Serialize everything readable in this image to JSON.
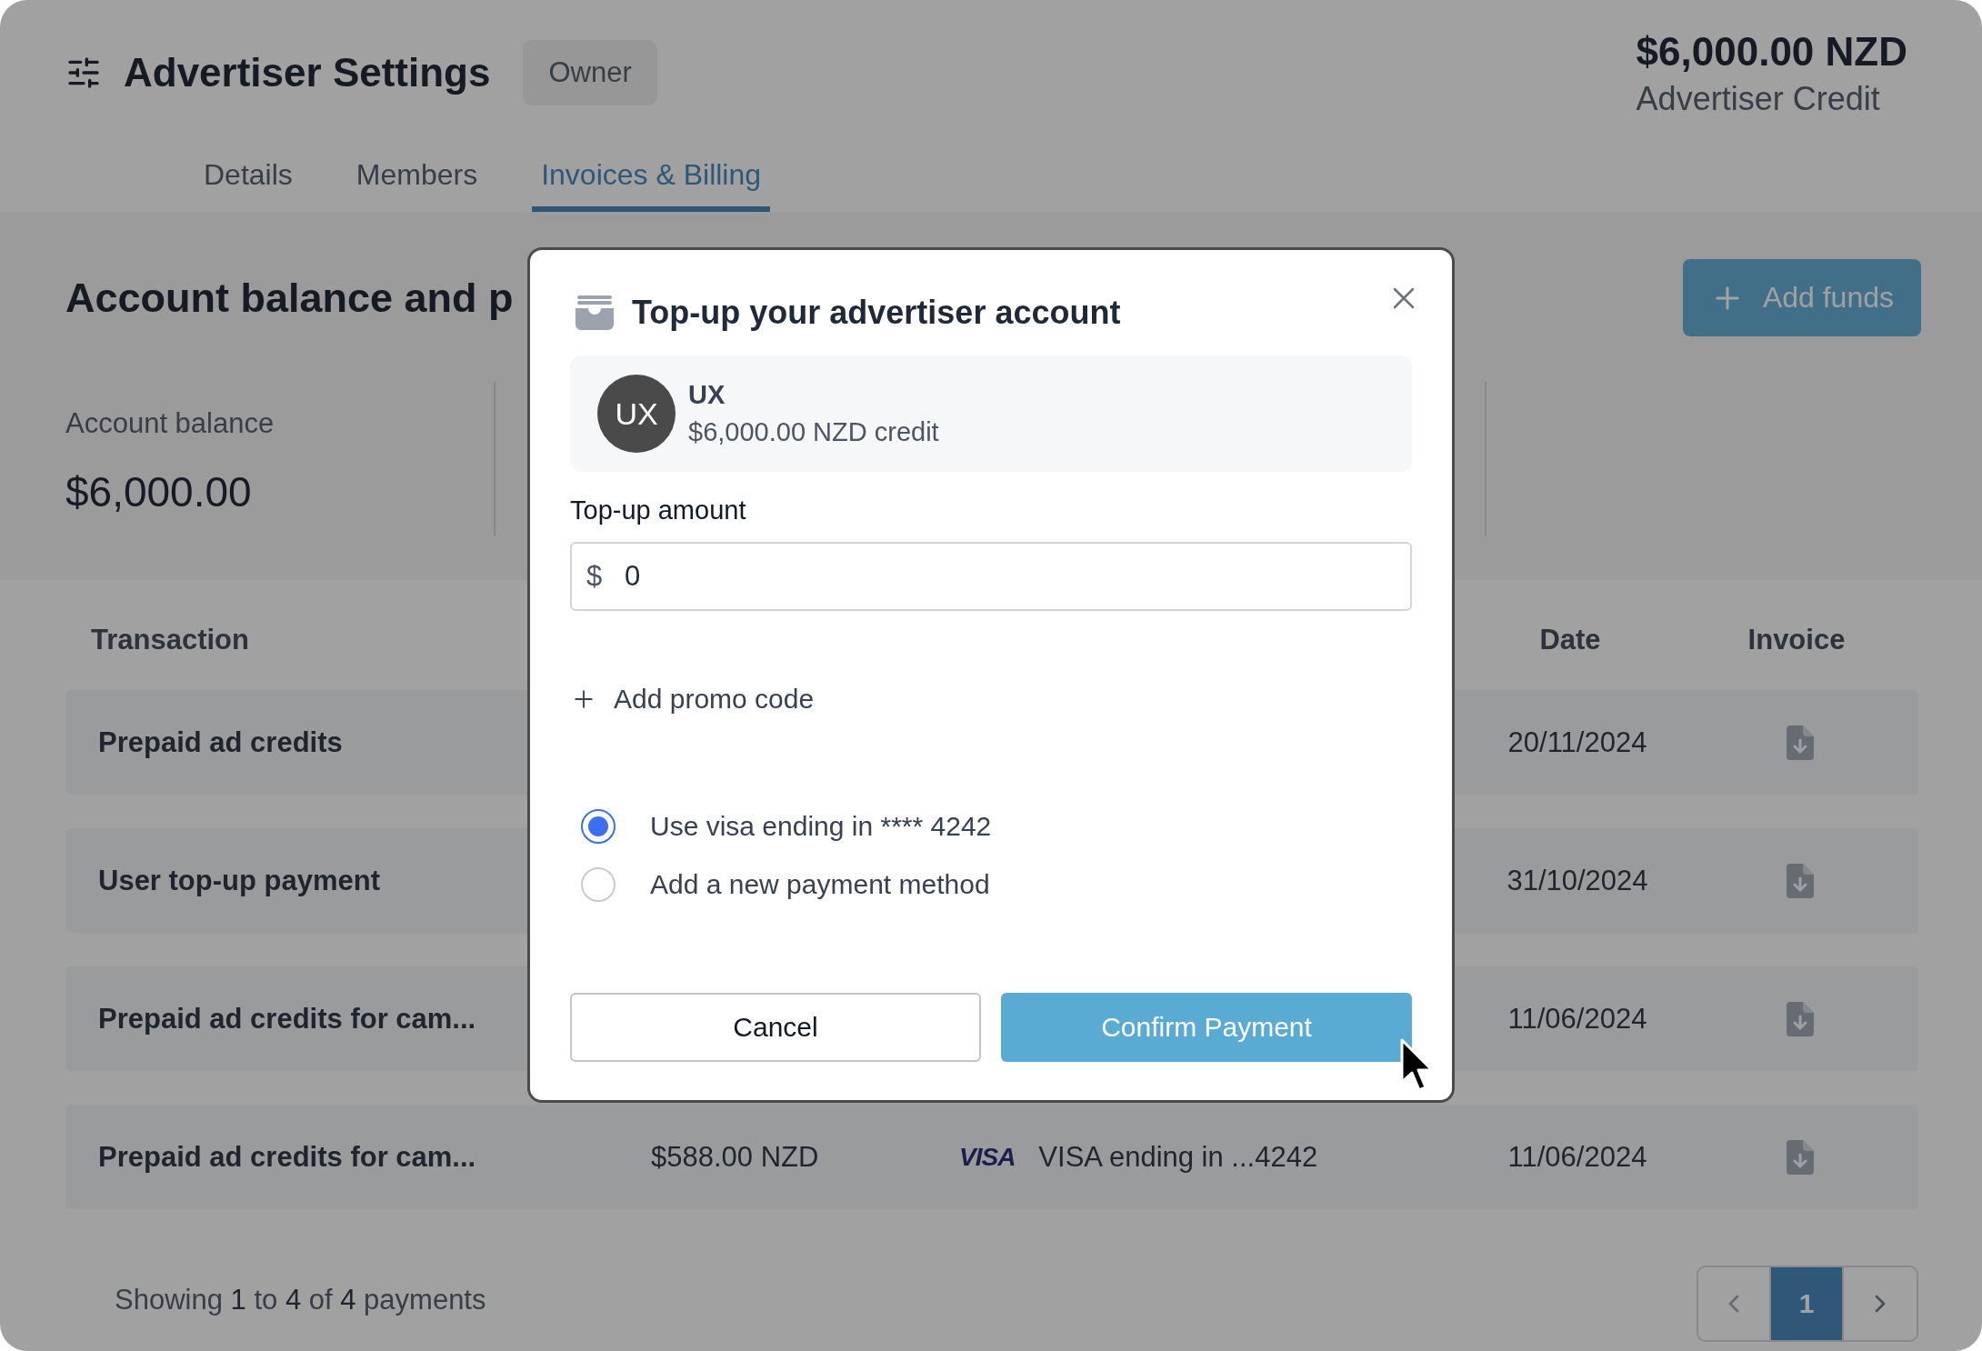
{
  "header": {
    "title": "Advertiser Settings",
    "role_badge": "Owner",
    "credit_amount": "$6,000.00 NZD",
    "credit_label": "Advertiser Credit"
  },
  "tabs": [
    {
      "label": "Details",
      "selected": false
    },
    {
      "label": "Members",
      "selected": false
    },
    {
      "label": "Invoices & Billing",
      "selected": true
    }
  ],
  "balance_section": {
    "heading": "Account balance and p",
    "add_funds_button": "Add funds",
    "stats": [
      {
        "label": "Account balance",
        "value": "$6,000.00"
      }
    ]
  },
  "table": {
    "column_headers": {
      "transaction": "Transaction",
      "date": "Date",
      "invoice": "Invoice"
    },
    "rows": [
      {
        "transaction": "Prepaid ad credits",
        "date": "20/11/2024"
      },
      {
        "transaction": "User top-up payment",
        "date": "31/10/2024"
      },
      {
        "transaction": "Prepaid ad credits for cam...",
        "date": "11/06/2024"
      },
      {
        "transaction": "Prepaid ad credits for cam...",
        "amount": "$588.00 NZD",
        "card_brand": "VISA",
        "payment_method": "VISA ending in ...4242",
        "date": "11/06/2024"
      }
    ]
  },
  "footer": {
    "summary": "Showing **1** to **4** of **4** payments",
    "pages": [
      {
        "label": "1",
        "selected": true
      }
    ]
  },
  "modal": {
    "title": "Top-up your advertiser account",
    "account": {
      "initials": "UX",
      "name": "UX",
      "credit": "$6,000.00 NZD credit"
    },
    "amount_label": "Top-up amount",
    "currency_symbol": "$",
    "amount_value": "0",
    "promo_link": "Add promo code",
    "payment_options": [
      {
        "label": "Use visa ending in **** 4242",
        "selected": true
      },
      {
        "label": "Add a new payment method",
        "selected": false
      }
    ],
    "cancel_button": "Cancel",
    "confirm_button": "Confirm Payment"
  }
}
